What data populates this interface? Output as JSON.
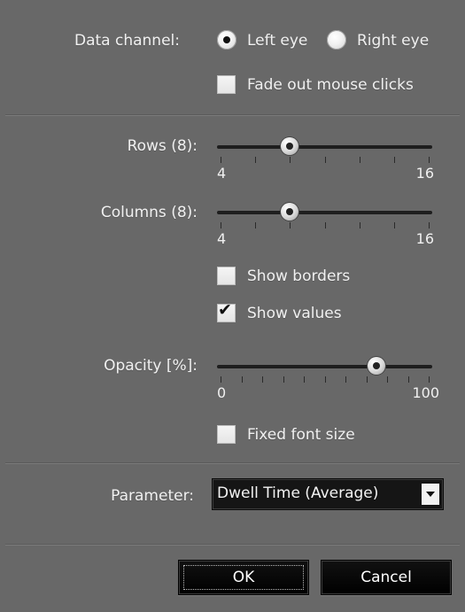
{
  "data_channel": {
    "label": "Data channel:",
    "options": [
      {
        "label": "Left eye",
        "selected": true
      },
      {
        "label": "Right eye",
        "selected": false
      }
    ]
  },
  "fade_out_mouse_clicks": {
    "label": "Fade out mouse clicks",
    "checked": false
  },
  "rows": {
    "label": "Rows (8):",
    "min": "4",
    "max": "16",
    "value": 8,
    "min_value": 4,
    "max_value": 16
  },
  "columns": {
    "label": "Columns (8):",
    "min": "4",
    "max": "16",
    "value": 8,
    "min_value": 4,
    "max_value": 16
  },
  "show_borders": {
    "label": "Show borders",
    "checked": false
  },
  "show_values": {
    "label": "Show values",
    "checked": true
  },
  "opacity": {
    "label": "Opacity [%]:",
    "min": "0",
    "max": "100",
    "value": 75,
    "min_value": 0,
    "max_value": 100
  },
  "fixed_font_size": {
    "label": "Fixed font size",
    "checked": false
  },
  "parameter": {
    "label": "Parameter:",
    "selected": "Dwell Time (Average)"
  },
  "buttons": {
    "ok": "OK",
    "cancel": "Cancel"
  },
  "colors": {
    "panel": "#686868",
    "slider_track": "#1e1e1e",
    "button_bg": "#000000",
    "text": "#f0f0f0"
  },
  "icons": {
    "combo_arrow": "chevron-down-icon",
    "checkmark": "check-icon"
  }
}
